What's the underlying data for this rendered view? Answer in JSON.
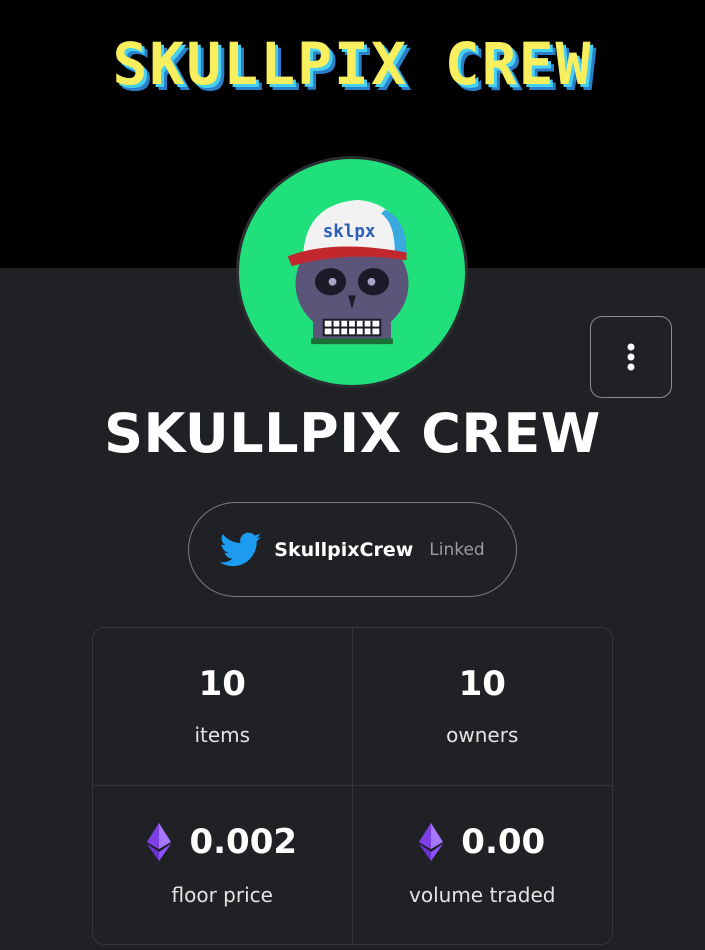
{
  "banner": {
    "title": "SKULLPIX CREW"
  },
  "avatar": {
    "cap_text": "sklpx"
  },
  "collection": {
    "name": "SKULLPIX CREW"
  },
  "social": {
    "handle": "SkullpixCrew",
    "status": "Linked",
    "icon": "twitter-icon"
  },
  "stats": {
    "items": {
      "value": "10",
      "label": "items"
    },
    "owners": {
      "value": "10",
      "label": "owners"
    },
    "floor_price": {
      "value": "0.002",
      "label": "floor price",
      "icon": "ethereum-icon"
    },
    "volume_traded": {
      "value": "0.00",
      "label": "volume traded",
      "icon": "ethereum-icon"
    }
  },
  "colors": {
    "background": "#202124",
    "banner": "#000000",
    "avatar_bg": "#1fe07a",
    "twitter": "#1d9bf0",
    "eth": "#8c52ff"
  }
}
